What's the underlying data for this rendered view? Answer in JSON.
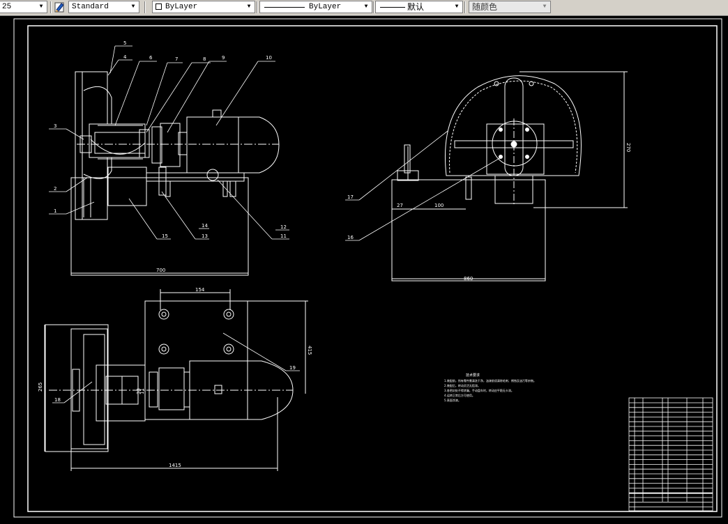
{
  "toolbar": {
    "scale_value": "25",
    "text_style": "Standard",
    "layer": "ByLayer",
    "linetype": "ByLayer",
    "lineweight": "默认",
    "color": "随颜色"
  },
  "drawing": {
    "balloons_front": [
      "5",
      "4",
      "6",
      "7",
      "8",
      "9",
      "10",
      "3",
      "2",
      "1",
      "14",
      "13",
      "15",
      "12",
      "11"
    ],
    "balloons_side": [
      "17",
      "16"
    ],
    "balloons_top": [
      "19",
      "18"
    ],
    "dims": {
      "front_width": "700",
      "side_height": "270",
      "side_27": "27",
      "side_100": "100",
      "side_bottom": "860",
      "top_154": "154",
      "top_right": "415",
      "top_left": "265",
      "top_bottom": "1415",
      "top_small_left": "33",
      "top_small_right": "11"
    },
    "notes_title": "技术要求",
    "notes": [
      "1.装配前，所有零件需清洗干净，油漆前须清除毛刺、锈蚀及油污等杂物。",
      "2.装配后，转动灵活无阻滞。",
      "3.各密封处不得渗漏，手动盘车时，转动应平稳无卡滞。",
      "4.运转正常后方可使用。",
      "5.表面涂漆。"
    ]
  }
}
